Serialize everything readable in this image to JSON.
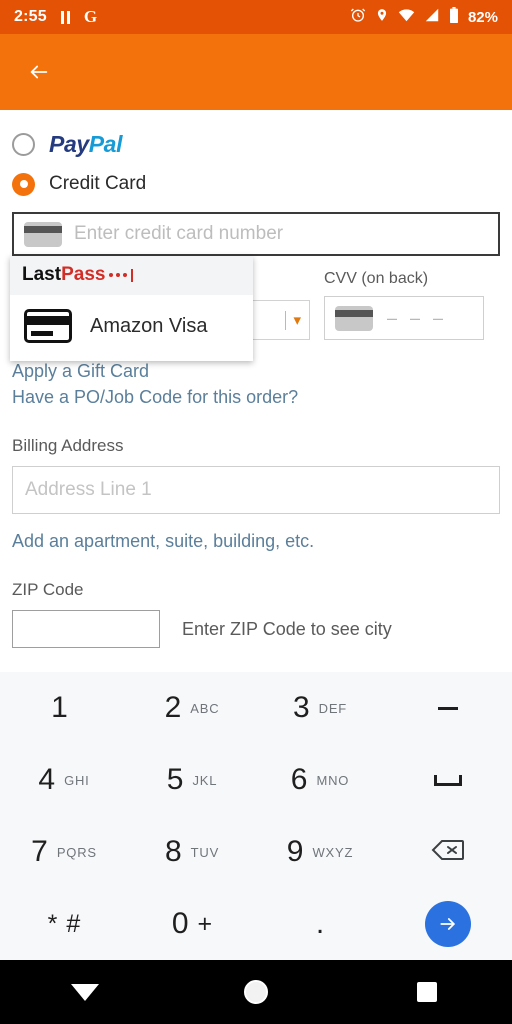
{
  "status_bar": {
    "time": "2:55",
    "battery_percent": "82%",
    "icons": [
      "pause-icon",
      "google-icon",
      "alarm-icon",
      "location-icon",
      "wifi-icon",
      "cellular-signal-icon",
      "battery-icon"
    ]
  },
  "app_bar": {
    "back_label": "←",
    "background_color": "#f4720b"
  },
  "payment": {
    "options": [
      {
        "id": "paypal",
        "label_part1": "Pay",
        "label_part2": "Pal",
        "selected": false
      },
      {
        "id": "credit-card",
        "label": "Credit Card",
        "selected": true
      }
    ],
    "card_number_placeholder": "Enter credit card number",
    "card_number_value": "",
    "expiration_month_value": "",
    "expiration_year_value": "",
    "cvv_label": "CVV (on back)",
    "cvv_placeholder": "– – –",
    "cvv_value": ""
  },
  "lastpass": {
    "logo_part1": "Last",
    "logo_part2": "Pass",
    "entry_name": "Amazon Visa",
    "entry_icon": "credit-card-icon",
    "accent_color": "#d32d27"
  },
  "links": {
    "gift_card": "Apply a Gift Card",
    "po_job_code": "Have a PO/Job Code for this order?",
    "apartment": "Add an apartment, suite, building, etc.",
    "color": "#5b7f9b"
  },
  "billing": {
    "section_label": "Billing Address",
    "address_placeholder": "Address Line 1",
    "address_value": "",
    "zip_label": "ZIP Code",
    "zip_value": "",
    "zip_hint": "Enter ZIP Code to see city"
  },
  "keyboard": {
    "accent_color": "#2b72e0",
    "rows": [
      [
        {
          "num": "1",
          "sub": ""
        },
        {
          "num": "2",
          "sub": "ABC"
        },
        {
          "num": "3",
          "sub": "DEF"
        },
        {
          "num": "",
          "sub": "",
          "icon": "dash-key"
        }
      ],
      [
        {
          "num": "4",
          "sub": "GHI"
        },
        {
          "num": "5",
          "sub": "JKL"
        },
        {
          "num": "6",
          "sub": "MNO"
        },
        {
          "num": "",
          "sub": "",
          "icon": "space-key"
        }
      ],
      [
        {
          "num": "7",
          "sub": "PQRS"
        },
        {
          "num": "8",
          "sub": "TUV"
        },
        {
          "num": "9",
          "sub": "WXYZ"
        },
        {
          "num": "",
          "sub": "",
          "icon": "backspace-key"
        }
      ],
      [
        {
          "num": "*",
          "sub": "#"
        },
        {
          "num": "0",
          "sub": "+"
        },
        {
          "num": ".",
          "sub": ""
        },
        {
          "num": "",
          "sub": "",
          "icon": "enter-key"
        }
      ]
    ]
  },
  "nav_bar": {
    "back": "down-triangle-icon",
    "home": "circle-icon",
    "recents": "square-icon"
  }
}
